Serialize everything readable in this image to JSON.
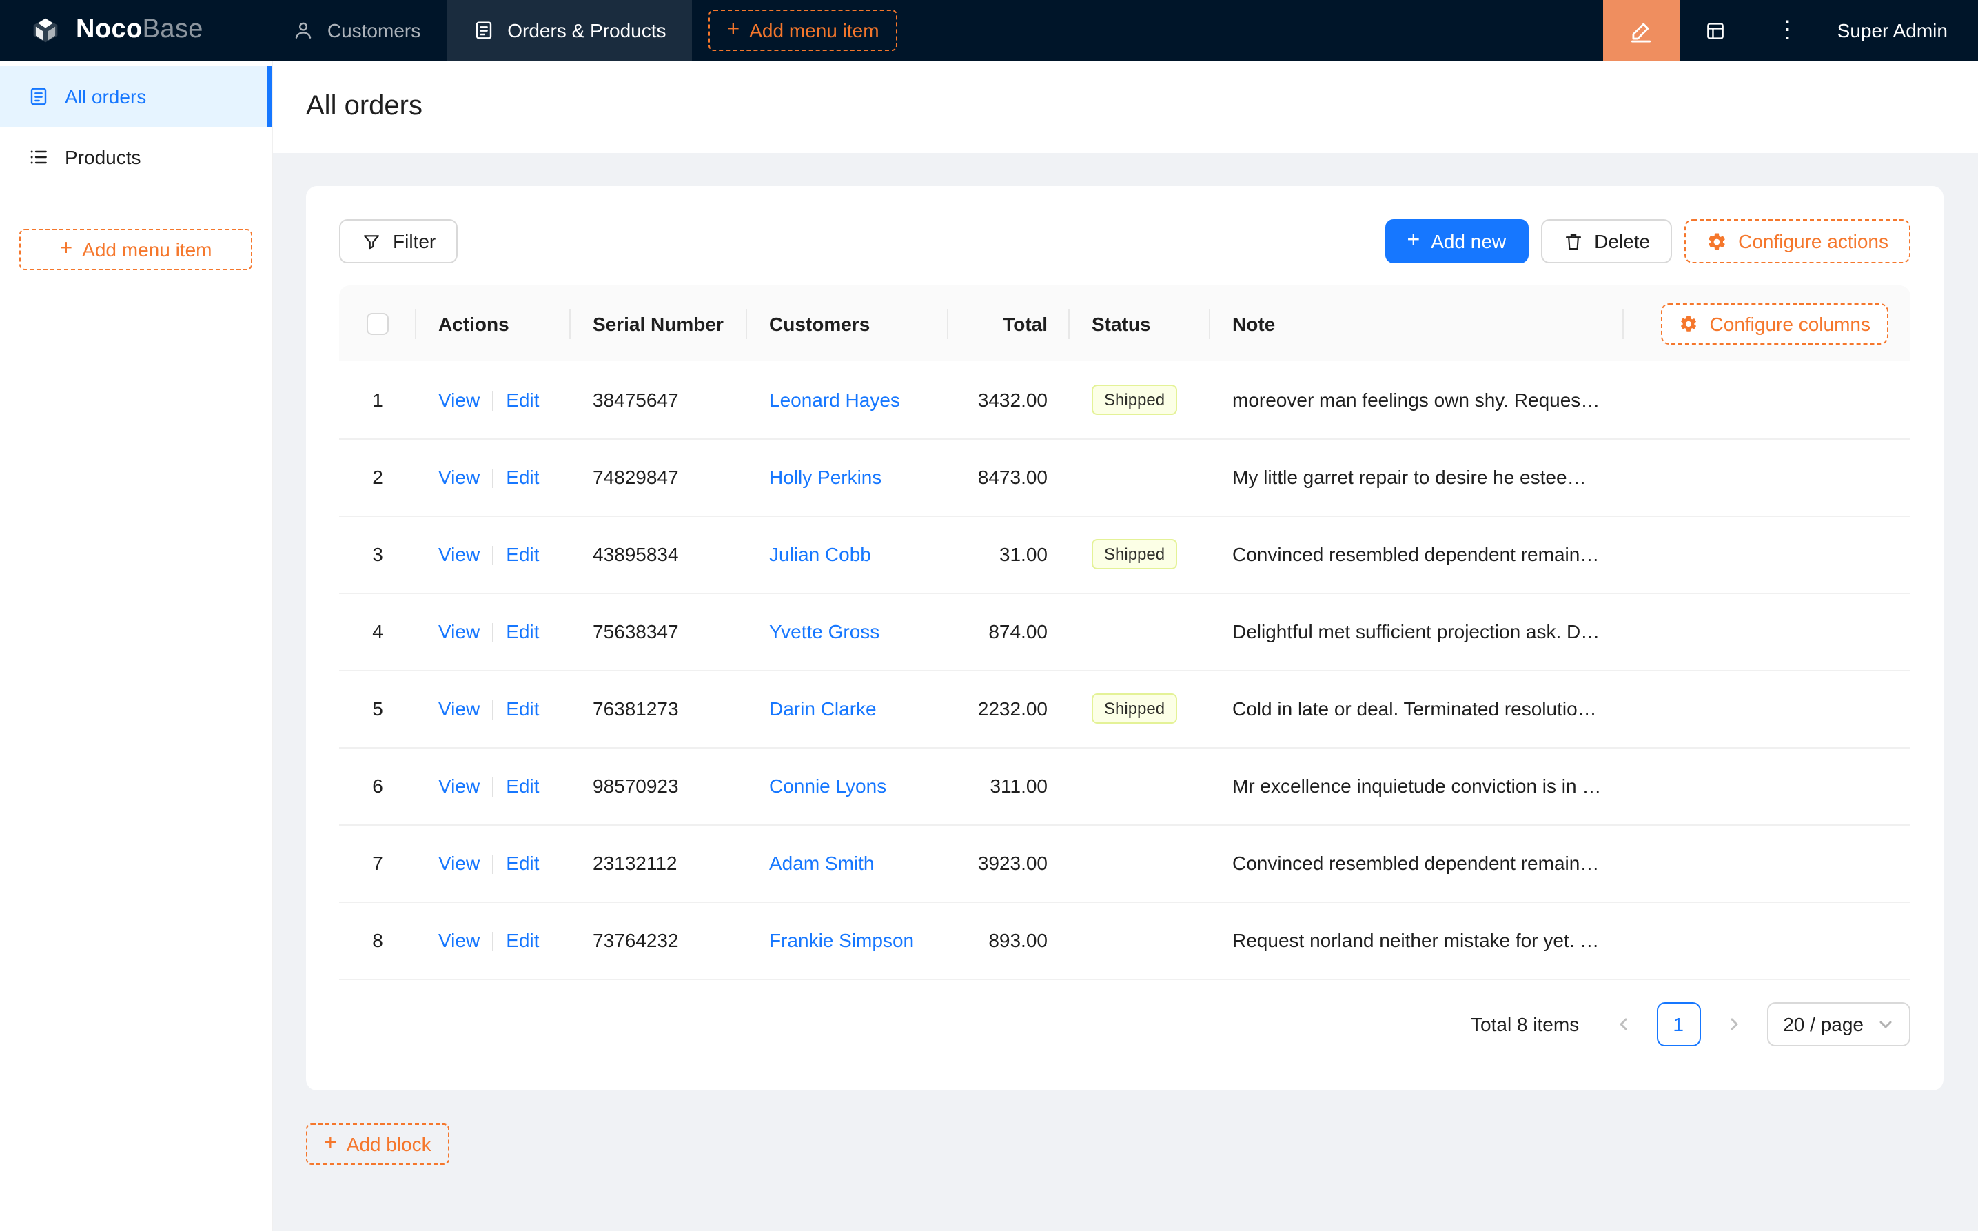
{
  "colors": {
    "primary": "#1677ff",
    "orange": "#f5772c",
    "salmon": "#ef8e5f",
    "header_bg": "#001529",
    "sidebar_active_bg": "#e6f4ff",
    "content_bg": "#f0f2f5",
    "tag_bg": "#fcffe6",
    "tag_border": "#e4f297"
  },
  "icons": {
    "plus": "+",
    "more_vertical": "⋮"
  },
  "topbar": {
    "logo_primary": "Noco",
    "logo_secondary": "Base",
    "nav": [
      {
        "label": "Customers"
      },
      {
        "label": "Orders & Products"
      }
    ],
    "add_menu_item": "Add menu item",
    "user": "Super Admin"
  },
  "sidebar": {
    "items": [
      {
        "label": "All orders"
      },
      {
        "label": "Products"
      }
    ],
    "add_menu_item": "Add menu item"
  },
  "page": {
    "title": "All orders"
  },
  "toolbar": {
    "filter": "Filter",
    "add_new": "Add new",
    "delete": "Delete",
    "configure_actions": "Configure actions"
  },
  "table": {
    "headers": {
      "actions": "Actions",
      "serial": "Serial Number",
      "customers": "Customers",
      "total": "Total",
      "status": "Status",
      "note": "Note",
      "configure_columns": "Configure columns"
    },
    "view": "View",
    "edit": "Edit",
    "rows": [
      {
        "n": "1",
        "serial": "38475647",
        "customer": "Leonard Hayes",
        "total": "3432.00",
        "status": "Shipped",
        "note": "moreover man feelings own shy. Request n..."
      },
      {
        "n": "2",
        "serial": "74829847",
        "customer": "Holly Perkins",
        "total": "8473.00",
        "status": "",
        "note": "My little garret repair to desire he esteem. ..."
      },
      {
        "n": "3",
        "serial": "43895834",
        "customer": "Julian Cobb",
        "total": "31.00",
        "status": "Shipped",
        "note": "Convinced resembled dependent remainde..."
      },
      {
        "n": "4",
        "serial": "75638347",
        "customer": "Yvette Gross",
        "total": "874.00",
        "status": "",
        "note": "Delightful met sufficient projection ask. De..."
      },
      {
        "n": "5",
        "serial": "76381273",
        "customer": "Darin Clarke",
        "total": "2232.00",
        "status": "Shipped",
        "note": "Cold in late or deal. Terminated resolution ..."
      },
      {
        "n": "6",
        "serial": "98570923",
        "customer": "Connie Lyons",
        "total": "311.00",
        "status": "",
        "note": "Mr excellence inquietude conviction is in u..."
      },
      {
        "n": "7",
        "serial": "23132112",
        "customer": "Adam Smith",
        "total": "3923.00",
        "status": "",
        "note": "Convinced resembled dependent remainde..."
      },
      {
        "n": "8",
        "serial": "73764232",
        "customer": "Frankie Simpson",
        "total": "893.00",
        "status": "",
        "note": "Request norland neither mistake for yet. Be..."
      }
    ]
  },
  "pagination": {
    "total": "Total 8 items",
    "page": "1",
    "page_size": "20 / page"
  },
  "footer": {
    "add_block": "Add block"
  }
}
